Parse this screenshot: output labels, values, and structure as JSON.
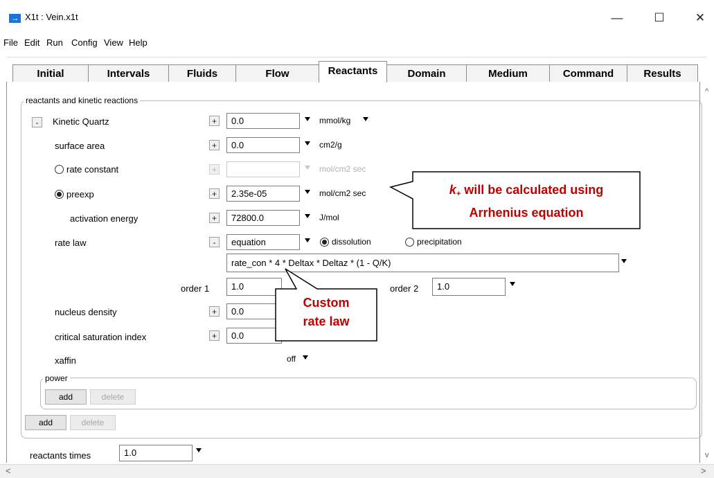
{
  "window": {
    "title": "X1t : Vein.x1t",
    "minimize": "—",
    "maximize": "☐",
    "close": "✕"
  },
  "menu": [
    {
      "label": "File"
    },
    {
      "label": "Edit"
    },
    {
      "label": "Run"
    },
    {
      "label": "Config"
    },
    {
      "label": "View"
    },
    {
      "label": "Help"
    }
  ],
  "tabs": [
    "Initial",
    "Intervals",
    "Fluids",
    "Flow",
    "Reactants",
    "Domain",
    "Medium",
    "Command",
    "Results"
  ],
  "active_tab": "Reactants",
  "group_title": "reactants and kinetic reactions",
  "kinetic": {
    "toggle": "-",
    "label": "Kinetic  Quartz",
    "value": "0.0",
    "unit": "mmol/kg"
  },
  "rows": {
    "surface_area": {
      "label": "surface area",
      "value": "0.0",
      "unit": "cm2/g"
    },
    "rate_constant": {
      "label": "rate constant",
      "value": "",
      "unit": "mol/cm2 sec"
    },
    "preexp": {
      "label": "preexp",
      "value": "2.35e-05",
      "unit": "mol/cm2 sec"
    },
    "activation_energy": {
      "label": "activation energy",
      "value": "72800.0",
      "unit": "J/mol"
    },
    "rate_law": {
      "label": "rate law",
      "value": "equation",
      "opt1": "dissolution",
      "opt2": "precipitation",
      "equation": "rate_con * 4 * Deltax * Deltaz * (1 - Q/K)"
    },
    "order1": {
      "label": "order 1",
      "value": "1.0"
    },
    "order2": {
      "label": "order 2",
      "value": "1.0"
    },
    "nucleus_density": {
      "label": "nucleus density",
      "value": "0.0"
    },
    "critical_saturation": {
      "label": "critical saturation index",
      "value": "0.0"
    },
    "xaffin": {
      "label": "xaffin",
      "value": "off"
    }
  },
  "power_group": {
    "title": "power",
    "add": "add",
    "delete": "delete"
  },
  "outer_buttons": {
    "add": "add",
    "delete": "delete"
  },
  "reactants_times": {
    "label": "reactants times",
    "value": "1.0"
  },
  "annotations": {
    "arrhenius_k": "k",
    "arrhenius_sub": "+",
    "arrhenius_line1_rest": " will be calculated using",
    "arrhenius_line2": "Arrhenius equation",
    "custom_line1": "Custom",
    "custom_line2": "rate law"
  },
  "colors": {
    "accent_annotation": "#c00000",
    "app_icon": "#1e73d6"
  }
}
